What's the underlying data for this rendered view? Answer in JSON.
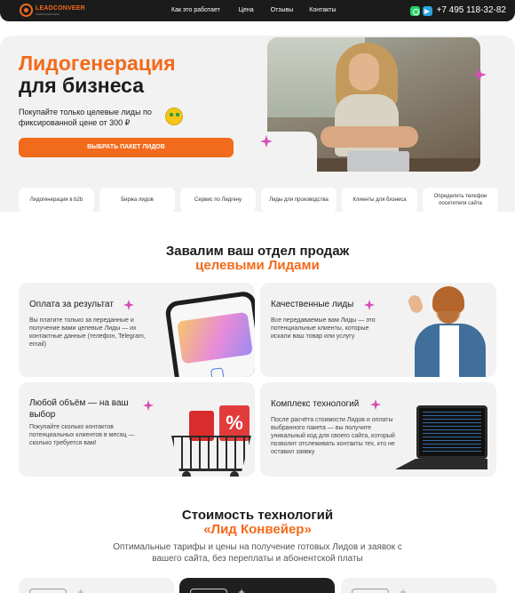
{
  "header": {
    "logo_name": "LEADCONVEER",
    "logo_tagline": "ЛИДОГЕНЕРАЦИЯ",
    "nav": [
      "Как это работает",
      "Цена",
      "Отзывы",
      "Контакты"
    ],
    "phone": "+7 495 118-32-82"
  },
  "hero": {
    "title_line1": "Лидогенерация",
    "title_line2": "для бизнеса",
    "description": "Покупайте только целевые лиды по фиксированной цене от 300 ₽",
    "cta_label": "ВЫБРАТЬ ПАКЕТ ЛИДОВ",
    "chips": [
      "Лидогенерация в b2b",
      "Биржа лидов",
      "Сервис по Лидгену",
      "Лиды для производства",
      "Клиенты для бизнеса",
      "Определить телефон посетителя сайта"
    ]
  },
  "benefits": {
    "title_line1": "Завалим ваш отдел продаж",
    "title_line2": "целевыми Лидами",
    "cards": [
      {
        "title": "Оплата за результат",
        "text": "Вы платите только за переданные и получение вами целевые Лиды — их контактные данные (телефон, Telegram, email)"
      },
      {
        "title": "Качественные лиды",
        "text": "Все передаваемые вам Лиды — это потенциальные клиенты, которые искали ваш товар или услугу"
      },
      {
        "title": "Любой объём — на ваш выбор",
        "text": "Покупайте сколько контактов потенциальных клиентов в месяц — сколько требуется вам!"
      },
      {
        "title": "Комплекс технологий",
        "text": "После расчёта стоимости Лидов и оплаты выбранного пакета — вы получите уникальный код для своего сайта, который позволит отслеживать контакты тех, кто не оставил заявку"
      }
    ],
    "sale_badge": "%"
  },
  "pricing": {
    "title_line1": "Стоимость технологий",
    "title_line2": "«Лид Конвейер»",
    "description": "Оптимальные тарифы и цены на получение готовых Лидов и заявок с вашего сайта, без переплаты и абонентской платы"
  },
  "colors": {
    "accent": "#f26a1b",
    "header_bg": "#1b1b1b",
    "card_bg": "#f2f2f2",
    "sparkle": "#d64fb5"
  },
  "icons": [
    "whatsapp-icon",
    "telegram-icon",
    "sparkle-icon",
    "money-face-icon"
  ]
}
